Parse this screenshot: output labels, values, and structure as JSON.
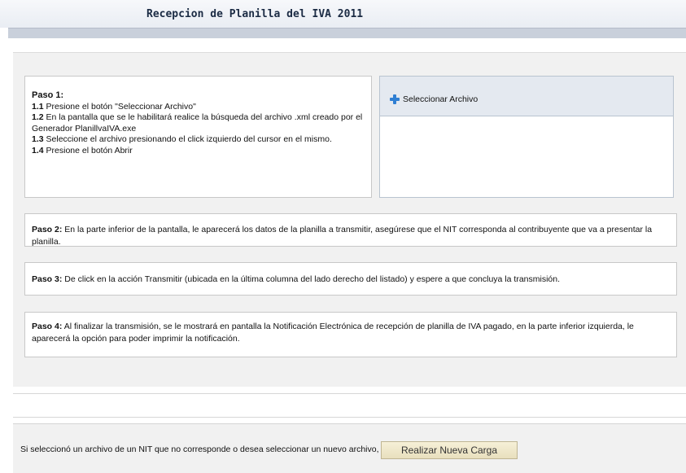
{
  "header": {
    "title": "Recepcion de Planilla del IVA 2011"
  },
  "step1": {
    "heading": "Paso 1:",
    "items": [
      {
        "num": "1.1",
        "text": " Presione el botón \"Seleccionar Archivo\""
      },
      {
        "num": "1.2",
        "text": " En la pantalla que se le habilitará realice la búsqueda del archivo .xml creado por el Generador PlanillvaIVA.exe"
      },
      {
        "num": "1.3",
        "text": " Seleccione el archivo presionando el click izquierdo del cursor en el mismo."
      },
      {
        "num": "1.4",
        "text": " Presione el botón Abrir"
      }
    ]
  },
  "upload": {
    "button_label": "Seleccionar Archivo",
    "icon": "plus-icon"
  },
  "step2": {
    "label": "Paso 2:",
    "text": " En la parte inferior de la pantalla, le aparecerá los datos de la planilla a transmitir, asegúrese que el NIT corresponda al contribuyente que va a presentar la planilla."
  },
  "step3": {
    "label": "Paso 3:",
    "text": " De click en la acción Transmitir (ubicada en la última columna del lado derecho del listado) y espere a que concluya la transmisión."
  },
  "step4": {
    "label": "Paso 4:",
    "text": " Al finalizar la transmisión, se le mostrará en pantalla la Notificación Electrónica de recepción de planilla de IVA pagado, en la parte inferior izquierda, le aparecerá la opción para poder imprimir la notificación."
  },
  "footer": {
    "prompt": "Si seleccionó un archivo de un NIT que no corresponde o desea seleccionar un nuevo archivo, pulse",
    "button_label": "Realizar Nueva Carga"
  },
  "colors": {
    "accent": "#2f7fd3",
    "header_band": "#c9d0db",
    "button_bg": "#efe7c9"
  }
}
